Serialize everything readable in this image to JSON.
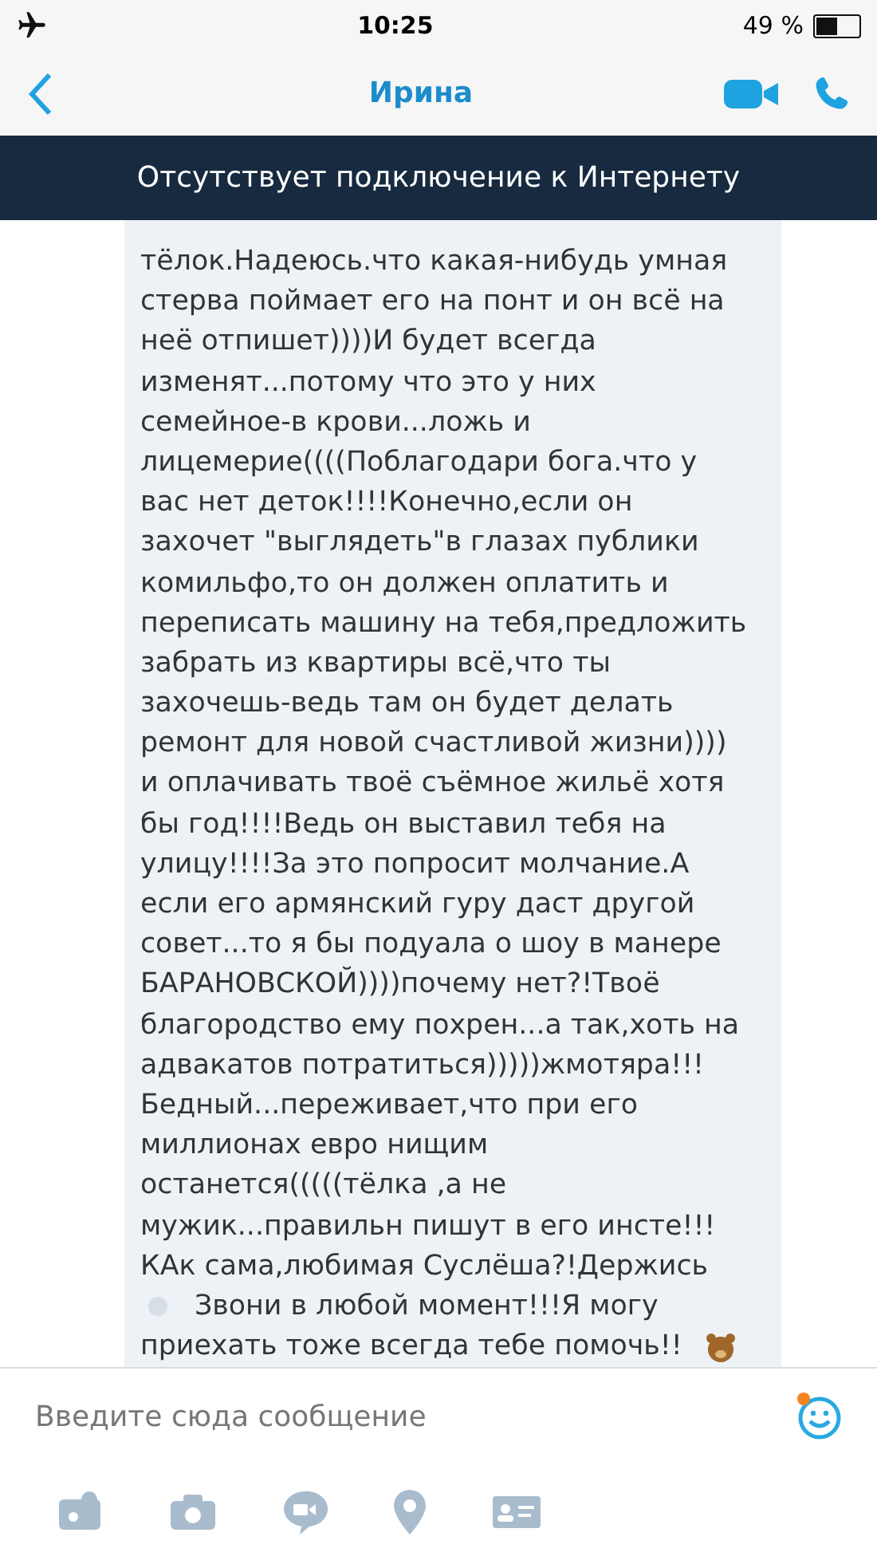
{
  "status_bar": {
    "time": "10:25",
    "battery": "49 %"
  },
  "nav": {
    "title": "Ирина"
  },
  "banner": "Отсутствует подключение к Интернету",
  "message": {
    "lines": [
      {
        "text": "тёлок.Надеюсь.что какая-нибудь умная",
        "lead_emoji": false
      },
      {
        "text": "стерва поймает его на понт и он всё на",
        "lead_emoji": false
      },
      {
        "text": "неё отпишет))))И будет всегда",
        "lead_emoji": false
      },
      {
        "text": "изменят...потому что это у них",
        "lead_emoji": false
      },
      {
        "text": "семейное-в крови...ложь и",
        "lead_emoji": false
      },
      {
        "text": "лицемерие((((Поблагодари бога.что у",
        "lead_emoji": false
      },
      {
        "text": "вас нет деток!!!!Конечно,если он",
        "lead_emoji": false
      },
      {
        "text": "захочет \"выглядеть\"в глазах публики",
        "lead_emoji": false
      },
      {
        "text": "комильфо,то он должен оплатить и",
        "lead_emoji": false
      },
      {
        "text": "переписать машину на тебя,предложить",
        "lead_emoji": false
      },
      {
        "text": "забрать из квартиры всё,что ты",
        "lead_emoji": false
      },
      {
        "text": "захочешь-ведь там он будет делать",
        "lead_emoji": false
      },
      {
        "text": "ремонт для новой счастливой жизни))))",
        "lead_emoji": false
      },
      {
        "text": "и оплачивать твоё съёмное жильё хотя",
        "lead_emoji": false
      },
      {
        "text": "бы год!!!!Ведь он выставил тебя на",
        "lead_emoji": false
      },
      {
        "text": "улицу!!!!За это попросит молчание.А",
        "lead_emoji": false
      },
      {
        "text": "если его армянский гуру даст другой",
        "lead_emoji": false
      },
      {
        "text": "совет...то я бы подуала о шоу в манере",
        "lead_emoji": false
      },
      {
        "text": "БАРАНОВСКОЙ))))почему нет?!Твоё",
        "lead_emoji": false
      },
      {
        "text": "благородство ему похрен...а так,хоть на",
        "lead_emoji": false
      },
      {
        "text": "адвакатов потратиться)))))жмотяра!!!",
        "lead_emoji": false
      },
      {
        "text": "Бедный...переживает,что при его",
        "lead_emoji": false
      },
      {
        "text": "миллионах евро нищим",
        "lead_emoji": false
      },
      {
        "text": "останется(((((тёлка ,а не",
        "lead_emoji": false
      },
      {
        "text": "мужик...правильн пишут в его инсте!!!",
        "lead_emoji": false
      },
      {
        "text": "КАк сама,любимая Суслёша?!Держись",
        "lead_emoji": false
      },
      {
        "text": "Звони в любой момент!!!Я могу",
        "lead_emoji": true
      },
      {
        "text": "приехать тоже всегда тебе помочь!!",
        "lead_emoji": false
      }
    ]
  },
  "composer": {
    "placeholder": "Введите сюда сообщение",
    "emoji_notification": true
  }
}
